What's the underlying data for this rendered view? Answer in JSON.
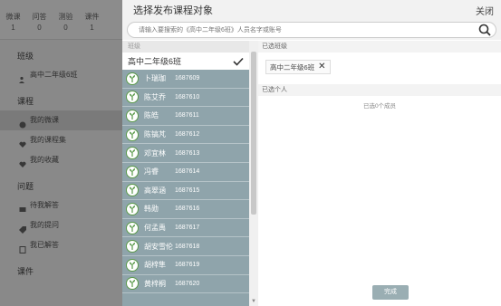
{
  "background": {
    "stats": [
      {
        "label": "微课",
        "value": "1"
      },
      {
        "label": "问答",
        "value": "0"
      },
      {
        "label": "测验",
        "value": "0"
      },
      {
        "label": "课件",
        "value": "1"
      }
    ],
    "sidebar": {
      "class_heading": "班级",
      "class_item": "高中二年级6班",
      "course_heading": "课程",
      "course_items": [
        "我的微课",
        "我的课程集",
        "我的收藏"
      ],
      "question_heading": "问题",
      "question_items": [
        "待我解答",
        "我的提问",
        "我已解答"
      ],
      "courseware_heading": "课件"
    }
  },
  "dialog": {
    "title": "选择发布课程对象",
    "close_label": "关闭",
    "search": {
      "placeholder": "请输入要搜索的《高中二年级6班》人员名字或账号",
      "value": ""
    },
    "left": {
      "heading": "班级",
      "class_name": "高中二年级6班",
      "members": [
        {
          "name": "卜瑞珈",
          "id": "1687609"
        },
        {
          "name": "陈艾乔",
          "id": "1687610"
        },
        {
          "name": "陈皓",
          "id": "1687611"
        },
        {
          "name": "陈镐芃",
          "id": "1687612"
        },
        {
          "name": "邓宜林",
          "id": "1687613"
        },
        {
          "name": "冯睿",
          "id": "1687614"
        },
        {
          "name": "高翠涵",
          "id": "1687615"
        },
        {
          "name": "韩勋",
          "id": "1687616"
        },
        {
          "name": "何孟禹",
          "id": "1687617"
        },
        {
          "name": "胡安雪伦",
          "id": "1687618"
        },
        {
          "name": "胡梓隼",
          "id": "1687619"
        },
        {
          "name": "黄梓桐",
          "id": "1687620"
        }
      ]
    },
    "right": {
      "selected_classes_heading": "已选班级",
      "selected_class_chip": "高中二年级6班",
      "selected_people_heading": "已选个人",
      "selected_people_count_text": "已选0个成员",
      "done_label": "完成"
    }
  },
  "colors": {
    "list_bg": "#8fa4ab",
    "done_button": "#9aaeb3",
    "avatar_green": "#5a9a4a"
  }
}
